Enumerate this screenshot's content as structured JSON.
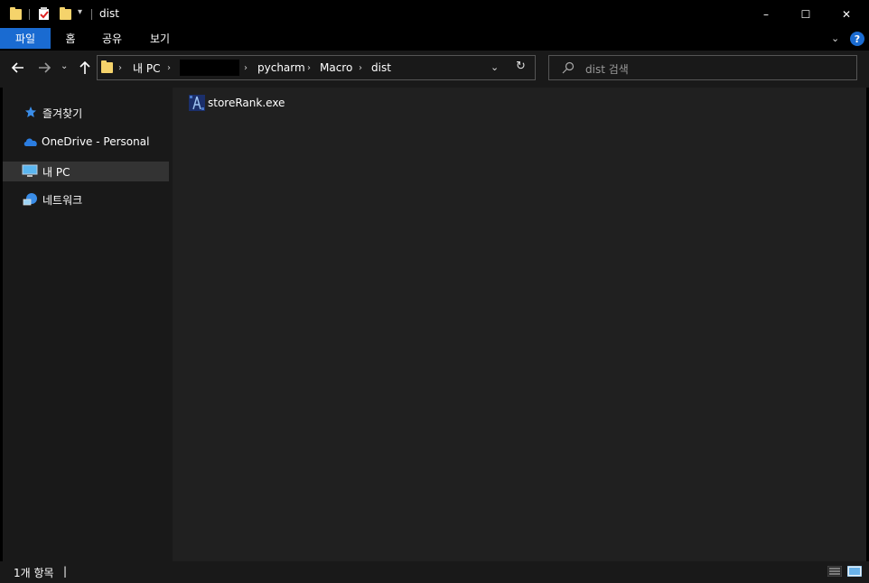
{
  "window": {
    "title": "dist",
    "quick_access": [
      "folder-icon",
      "properties-icon",
      "new-folder-icon"
    ],
    "controls": {
      "minimize": "–",
      "maximize": "☐",
      "close": "✕"
    }
  },
  "ribbon": {
    "tabs": [
      {
        "label": "파일",
        "active": true
      },
      {
        "label": "홈"
      },
      {
        "label": "공유"
      },
      {
        "label": "보기"
      }
    ],
    "help": "?"
  },
  "navigation": {
    "breadcrumb": [
      "내 PC",
      "",
      "pycharm",
      "Macro",
      "dist"
    ],
    "search_placeholder": "dist 검색"
  },
  "sidebar": {
    "items": [
      {
        "label": "즐겨찾기",
        "icon": "star-icon"
      },
      {
        "label": "OneDrive - Personal",
        "icon": "onedrive-icon"
      },
      {
        "label": "내 PC",
        "icon": "computer-icon",
        "selected": true
      },
      {
        "label": "네트워크",
        "icon": "network-icon"
      }
    ]
  },
  "files": [
    {
      "name": "storeRank.exe",
      "icon": "exe-icon"
    }
  ],
  "status": {
    "count": "1개 항목",
    "cursor": "|"
  },
  "colors": {
    "accent": "#1a6bd1",
    "background": "#202020",
    "panel": "#191919",
    "folder": "#f5d36b"
  }
}
